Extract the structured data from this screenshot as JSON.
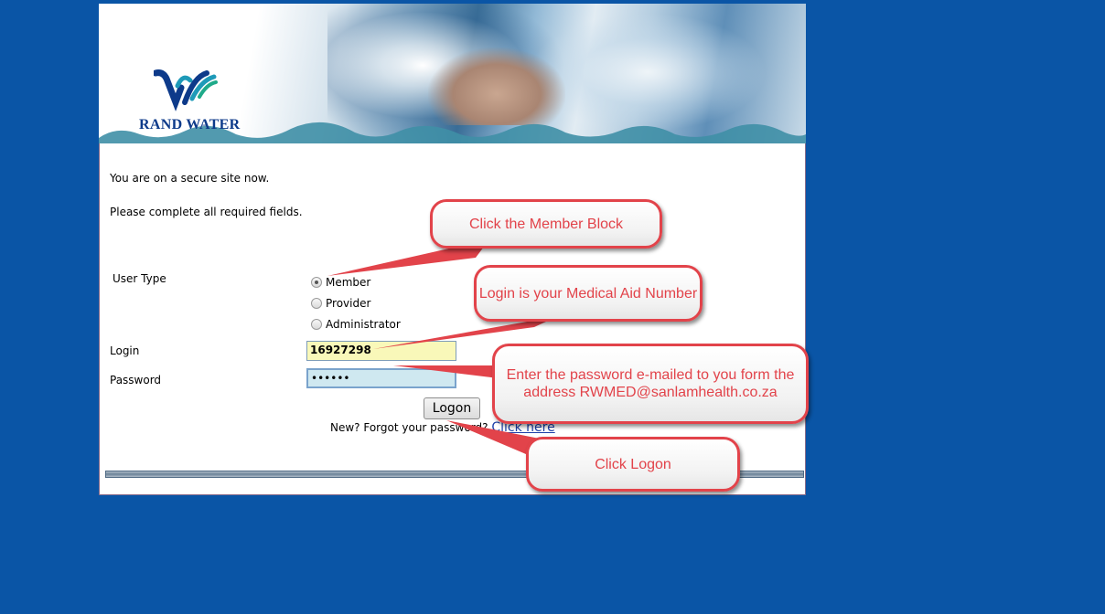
{
  "brand": {
    "name": "RAND WATER"
  },
  "intro": {
    "secure_text": "You are on a secure site now.",
    "required_text": "Please complete all required fields."
  },
  "form": {
    "user_type_label": "User Type",
    "user_types": [
      "Member",
      "Provider",
      "Administrator"
    ],
    "selected_user_type": "Member",
    "login_label": "Login",
    "login_value": "16927298",
    "password_label": "Password",
    "password_value": "••••••",
    "logon_button": "Logon",
    "forgot_text": "New? Forgot your password?",
    "forgot_link": "Click here"
  },
  "callouts": {
    "member": "Click the Member Block",
    "login": "Login is your Medical Aid Number",
    "password": "Enter the password e-mailed to you form the address RWMED@sanlamhealth.co.za",
    "logon": "Click Logon"
  },
  "colors": {
    "page_background": "#0a55a6",
    "callout_border": "#e2434a",
    "login_field_bg": "#f9f8b9",
    "password_field_bg": "#cfe8f0"
  }
}
